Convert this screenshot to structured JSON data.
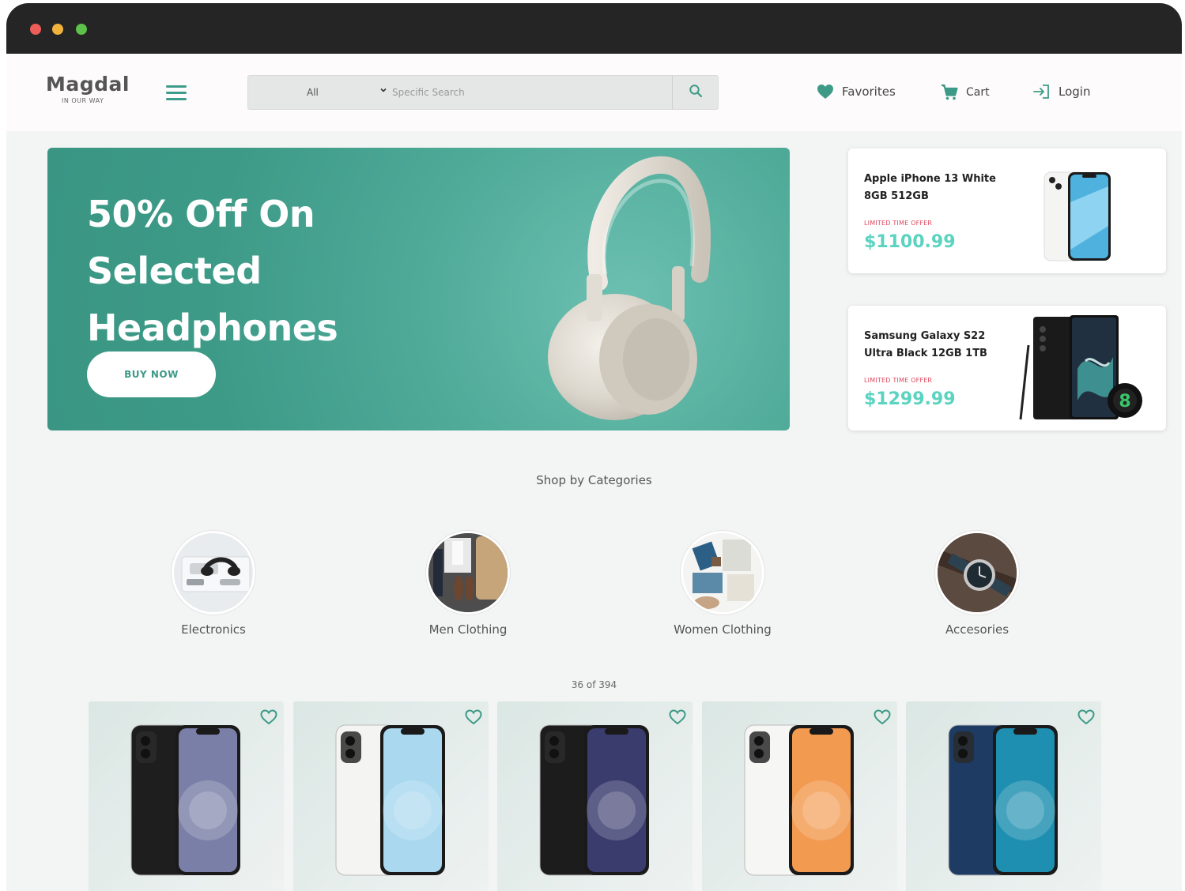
{
  "window": {
    "controls": {
      "close_color": "#ee5e58",
      "minimize_color": "#f0b43c",
      "maximize_color": "#5cc24a"
    }
  },
  "brand": {
    "name": "Magdal",
    "tagline": "IN OUR WAY",
    "accent": "#3d9a87",
    "price_color": "#5ad3c0",
    "offer_color": "#e0475c"
  },
  "search": {
    "category": "All",
    "placeholder": "Specific Search"
  },
  "nav": {
    "favorites": "Favorites",
    "cart": "Cart",
    "login": "Login"
  },
  "hero": {
    "lines": [
      "50% Off On",
      "Selected",
      "Headphones"
    ],
    "button": "BUY NOW"
  },
  "promos": [
    {
      "name_line1": "Apple iPhone 13 White",
      "name_line2": "8GB 512GB",
      "offer": "LIMITED TIME OFFER",
      "price": "$1100.99"
    },
    {
      "name_line1": "Samsung Galaxy S22",
      "name_line2": "Ultra Black 12GB 1TB",
      "offer": "LIMITED TIME OFFER",
      "price": "$1299.99"
    }
  ],
  "categories": {
    "title": "Shop by Categories",
    "items": [
      {
        "label": "Electronics"
      },
      {
        "label": "Men Clothing"
      },
      {
        "label": "Women Clothing"
      },
      {
        "label": "Accesories"
      }
    ]
  },
  "products": {
    "count": "36 of 394",
    "items": [
      {
        "icon": "black-iphone-11",
        "body": "#1e1e1e",
        "screen": "#7a7fa8"
      },
      {
        "icon": "white-iphone-11",
        "body": "#f4f4f2",
        "screen": "#a9d8ef"
      },
      {
        "icon": "black-iphone-12",
        "body": "#1c1c1c",
        "screen": "#3b3c6e"
      },
      {
        "icon": "white-iphone-12",
        "body": "#f6f6f4",
        "screen": "#f29a50"
      },
      {
        "icon": "blue-iphone-12",
        "body": "#1d3b63",
        "screen": "#1e8fb0"
      }
    ]
  }
}
